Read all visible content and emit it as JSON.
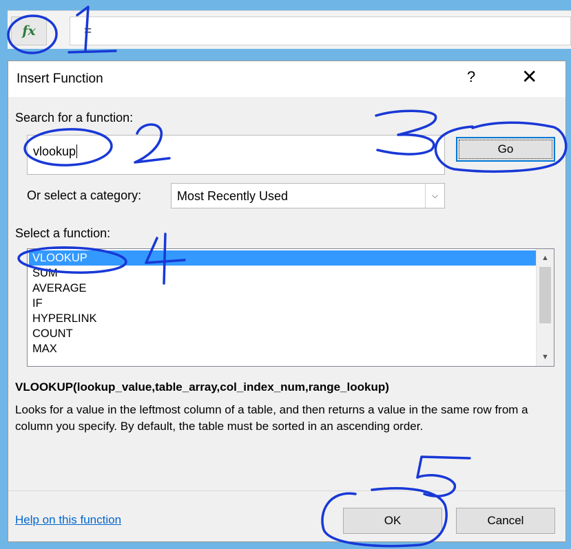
{
  "formula_bar": {
    "fx_label": "fx",
    "formula_text": "="
  },
  "dialog": {
    "title": "Insert Function",
    "help_label": "?",
    "close_label": "✕",
    "search": {
      "label": "Search for a function:",
      "value": "vlookup",
      "go_label": "Go"
    },
    "category": {
      "label": "Or select a category:",
      "value": "Most Recently Used"
    },
    "functions": {
      "label": "Select a function:",
      "items": [
        "VLOOKUP",
        "SUM",
        "AVERAGE",
        "IF",
        "HYPERLINK",
        "COUNT",
        "MAX"
      ],
      "selected": "VLOOKUP"
    },
    "signature": "VLOOKUP(lookup_value,table_array,col_index_num,range_lookup)",
    "description": "Looks for a value in the leftmost column of a table, and then returns a value in the same row from a column you specify. By default, the table must be sorted in an ascending order.",
    "help_link": "Help on this function",
    "ok_label": "OK",
    "cancel_label": "Cancel"
  },
  "annotations": {
    "numbers": [
      "1",
      "2",
      "3",
      "4",
      "5"
    ],
    "color": "#1838d6"
  },
  "colors": {
    "background": "#6fb6e6",
    "selection": "#3399ff",
    "focus_border": "#0078d7",
    "link": "#0066cc"
  }
}
